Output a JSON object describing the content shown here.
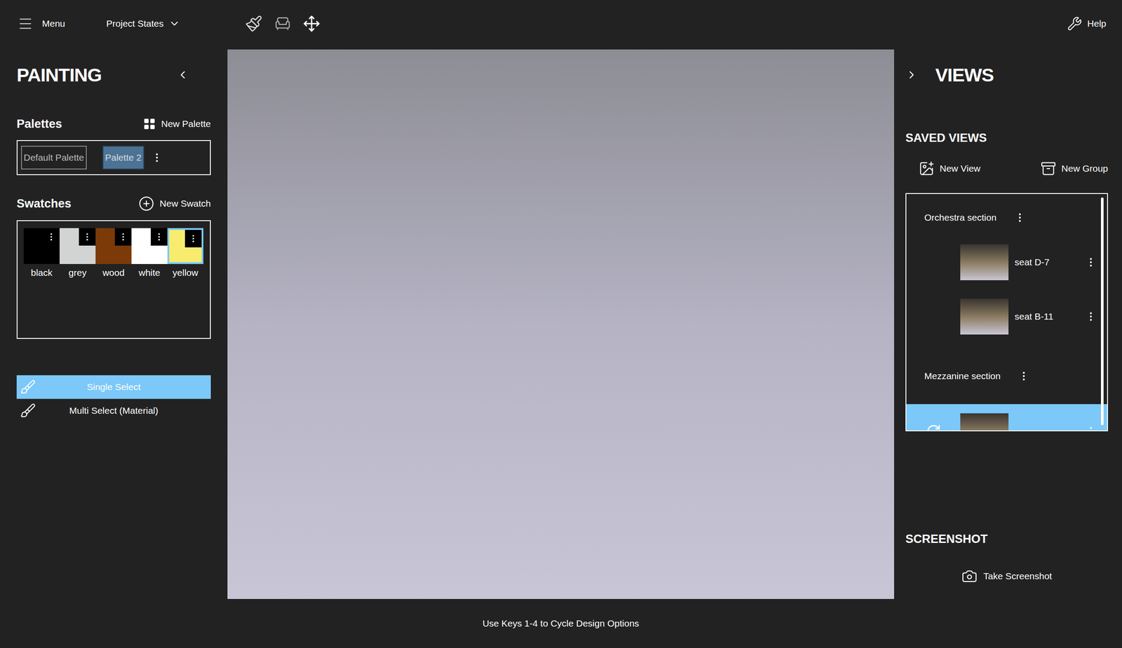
{
  "topbar": {
    "menu": "Menu",
    "project_states": "Project States",
    "help": "Help"
  },
  "painting": {
    "title": "PAINTING",
    "palettes_title": "Palettes",
    "new_palette": "New Palette",
    "palettes": [
      {
        "label": "Default Palette",
        "selected": false
      },
      {
        "label": "Palette 2",
        "selected": true
      }
    ],
    "swatches_title": "Swatches",
    "new_swatch": "New Swatch",
    "swatches": [
      {
        "label": "black",
        "color": "#000000",
        "selected": false
      },
      {
        "label": "grey",
        "color": "#d2d3d3",
        "selected": false
      },
      {
        "label": "wood",
        "color": "#7b3a07",
        "selected": false
      },
      {
        "label": "white",
        "color": "#ffffff",
        "selected": false
      },
      {
        "label": "yellow",
        "color": "#f8ec6f",
        "selected": true
      }
    ],
    "select_modes": [
      {
        "label": "Single Select",
        "selected": true
      },
      {
        "label": "Multi Select (Material)",
        "selected": false
      }
    ]
  },
  "views": {
    "title": "VIEWS",
    "saved_views_title": "SAVED VIEWS",
    "new_view": "New View",
    "new_group": "New Group",
    "items": [
      {
        "kind": "group",
        "label": "Orchestra section",
        "selected": false
      },
      {
        "kind": "view",
        "label": "seat D-7",
        "selected": false
      },
      {
        "kind": "view",
        "label": "seat B-11",
        "selected": false
      },
      {
        "kind": "group",
        "label": "Mezzanine section",
        "selected": false
      },
      {
        "kind": "view",
        "label": "",
        "selected": true
      }
    ]
  },
  "screenshot": {
    "title": "SCREENSHOT",
    "button": "Take Screenshot"
  },
  "hint": "Use Keys 1-4 to Cycle Design Options"
}
